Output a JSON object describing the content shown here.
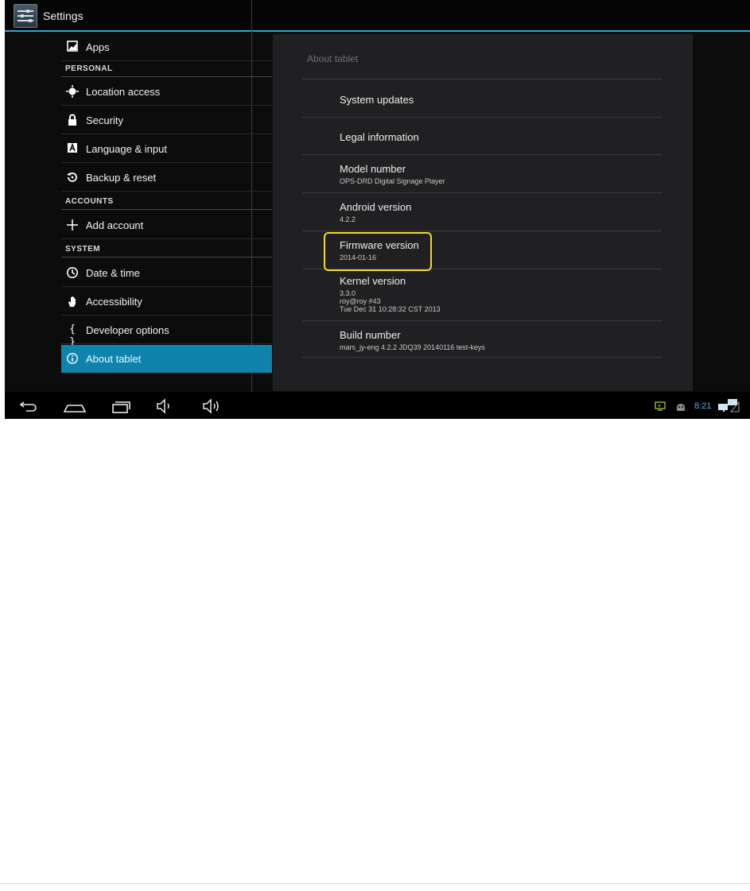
{
  "app": {
    "title": "Settings"
  },
  "left": {
    "apps_label": "Apps",
    "personal_header": "PERSONAL",
    "personal": [
      {
        "label": "Location access",
        "icon": "location-target-icon"
      },
      {
        "label": "Security",
        "icon": "lock-icon"
      },
      {
        "label": "Language & input",
        "icon": "keyboard-a-icon"
      },
      {
        "label": "Backup & reset",
        "icon": "restore-icon"
      }
    ],
    "accounts_header": "ACCOUNTS",
    "add_account": "Add account",
    "system_header": "SYSTEM",
    "system": [
      {
        "label": "Date & time",
        "icon": "clock-icon"
      },
      {
        "label": "Accessibility",
        "icon": "hand-icon"
      },
      {
        "label": "Developer options",
        "icon": "braces-icon"
      },
      {
        "label": "About tablet",
        "icon": "info-icon"
      }
    ]
  },
  "about": {
    "title": "About tablet",
    "system_updates": "System updates",
    "legal_information": "Legal information",
    "model_number": {
      "title": "Model number",
      "value": "OPS-DRD Digital Signage Player"
    },
    "android_version": {
      "title": "Android version",
      "value": "4.2.2"
    },
    "firmware_version": {
      "title": "Firmware version",
      "value": "2014-01-16"
    },
    "kernel_version": {
      "title": "Kernel version",
      "line1": "3.3.0",
      "line2": "roy@roy #43",
      "line3": "Tue Dec 31 10:28:32 CST 2013"
    },
    "build_number": {
      "title": "Build number",
      "value": "mars_jy-eng 4.2.2 JDQ39 20140116 test-keys"
    }
  },
  "status": {
    "time": "8:21"
  },
  "colors": {
    "accent": "#0e84ad",
    "highlight": "#f0d92d",
    "clock": "#3fb3e6"
  }
}
